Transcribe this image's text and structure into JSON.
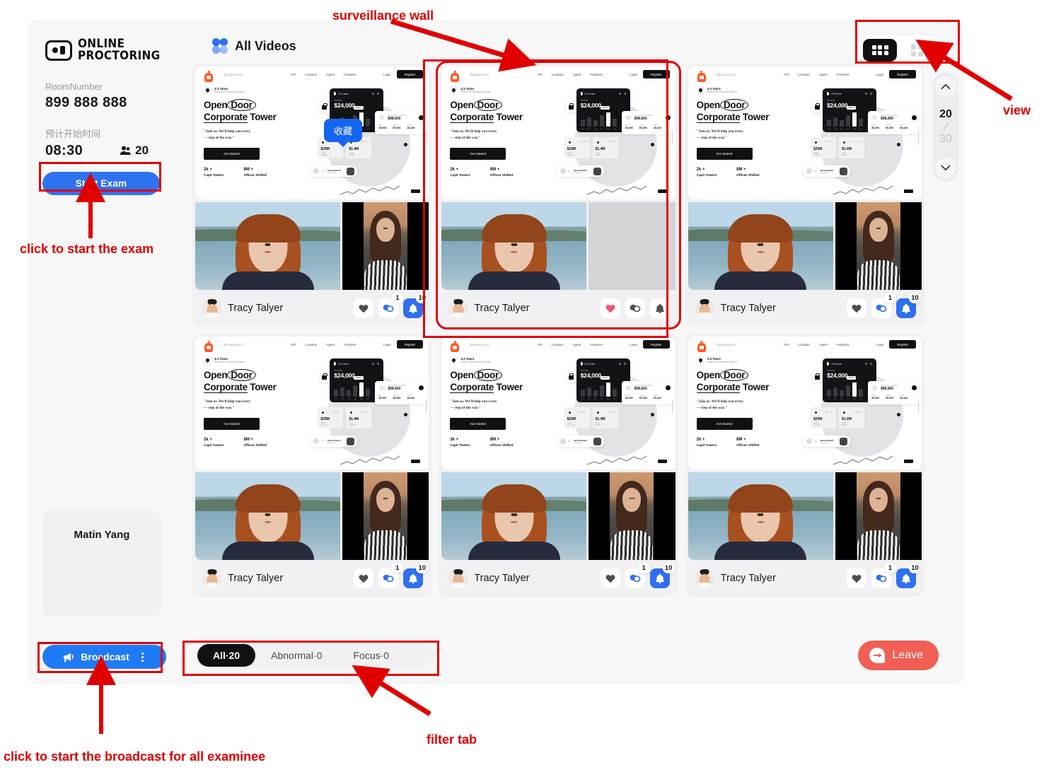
{
  "sidebar": {
    "logo_line1": "Online",
    "logo_line2": "Proctoring",
    "room_label": "RoomNumber",
    "room_number": "899 888 888",
    "time_label": "预计开始时间",
    "time_value": "08:30",
    "people_count": "20",
    "start_button": "Start Exam",
    "presenter_name": "Matin Yang",
    "broadcast_button": "Broadcast"
  },
  "header": {
    "title": "All Videos",
    "view_toggle": {
      "grid_view": "grid-6",
      "card_view": "grid-4",
      "active": "grid-6"
    }
  },
  "pager": {
    "current": "20",
    "separator": "/",
    "total": "30"
  },
  "filters": {
    "tabs": [
      {
        "label": "All·20",
        "active": true
      },
      {
        "label": "Abnormal·0",
        "active": false
      },
      {
        "label": "Focus·0",
        "active": false
      }
    ]
  },
  "leave_button": "Leave",
  "tooltip": {
    "text": "收藏"
  },
  "screen_share": {
    "brand": "@propertty.io",
    "nav_links": [
      "API",
      "Location",
      "Agent",
      "Features"
    ],
    "login": "Login",
    "register": "Register",
    "rating": "4.3 Stars",
    "rating_sub": "Read Our Success Stories",
    "headline_1": "Open",
    "headline_oval": "Door",
    "headline_2": "Corporate Tower",
    "quote_line1": "\"Join us. We'll help you every",
    "quote_line2": "— step of the way.\"",
    "cta": "Get Started",
    "stats": [
      {
        "value": "2k +",
        "label": "Capit Towers"
      },
      {
        "value": "8M +",
        "label": "Offices Shifted"
      }
    ],
    "dashboard": {
      "brand": "VR Estate",
      "period": "Monthly",
      "amount": "$24,000",
      "tip": "March",
      "axis": [
        "Jan",
        "Feb",
        "Mar",
        "Apr",
        "May",
        "Jun"
      ],
      "card_label": "Successful Landlord",
      "card_amount": "$98,660",
      "metrics": [
        {
          "key": "Rent",
          "value": "36,000"
        },
        {
          "key": "Sold In",
          "value": "50,000"
        },
        {
          "key": "Views",
          "value": "28,440"
        }
      ],
      "tiles": [
        {
          "value": "$29M",
          "label_1": "Yearly",
          "label_2": "Turnover",
          "pill": "Total +80 +"
        },
        {
          "value": "$1.4M",
          "label_1": "Land",
          "label_2": "Wealth",
          "pill": "Total +88 +"
        }
      ],
      "person": {
        "name": "Jamie Edward",
        "role": "Supervisor",
        "tag": "VR +"
      }
    }
  },
  "cards": [
    {
      "name": "Tracy Talyer",
      "selected": false,
      "heart": "dark",
      "chat_badge": "1",
      "bell_badge": "10",
      "bell_filled": true,
      "side_cam": "active",
      "tooltip": true
    },
    {
      "name": "Tracy Talyer",
      "selected": true,
      "heart": "red",
      "chat_badge": "",
      "bell_badge": "",
      "bell_filled": false,
      "side_cam": "blank",
      "tooltip": false
    },
    {
      "name": "Tracy Talyer",
      "selected": false,
      "heart": "dark",
      "chat_badge": "1",
      "bell_badge": "10",
      "bell_filled": true,
      "side_cam": "active",
      "tooltip": false
    },
    {
      "name": "Tracy Talyer",
      "selected": false,
      "heart": "dark",
      "chat_badge": "1",
      "bell_badge": "10",
      "bell_filled": true,
      "side_cam": "active",
      "tooltip": false
    },
    {
      "name": "Tracy Talyer",
      "selected": false,
      "heart": "dark",
      "chat_badge": "1",
      "bell_badge": "10",
      "bell_filled": true,
      "side_cam": "active",
      "tooltip": false
    },
    {
      "name": "Tracy Talyer",
      "selected": false,
      "heart": "dark",
      "chat_badge": "1",
      "bell_badge": "10",
      "bell_filled": true,
      "side_cam": "active",
      "tooltip": false
    }
  ],
  "annotations": [
    {
      "id": "surveillance-wall",
      "text": "surveillance wall"
    },
    {
      "id": "view",
      "text": "view"
    },
    {
      "id": "start-exam",
      "text": "click to start the exam"
    },
    {
      "id": "broadcast",
      "text": "click to start the broadcast for all examinee"
    },
    {
      "id": "filter-tab",
      "text": "filter tab"
    }
  ],
  "colors": {
    "accent_blue": "#2f6ff0",
    "annotation_red": "#e00000",
    "leave_red": "#f15f55",
    "heart_red": "#f2556a",
    "active_black": "#111111"
  }
}
